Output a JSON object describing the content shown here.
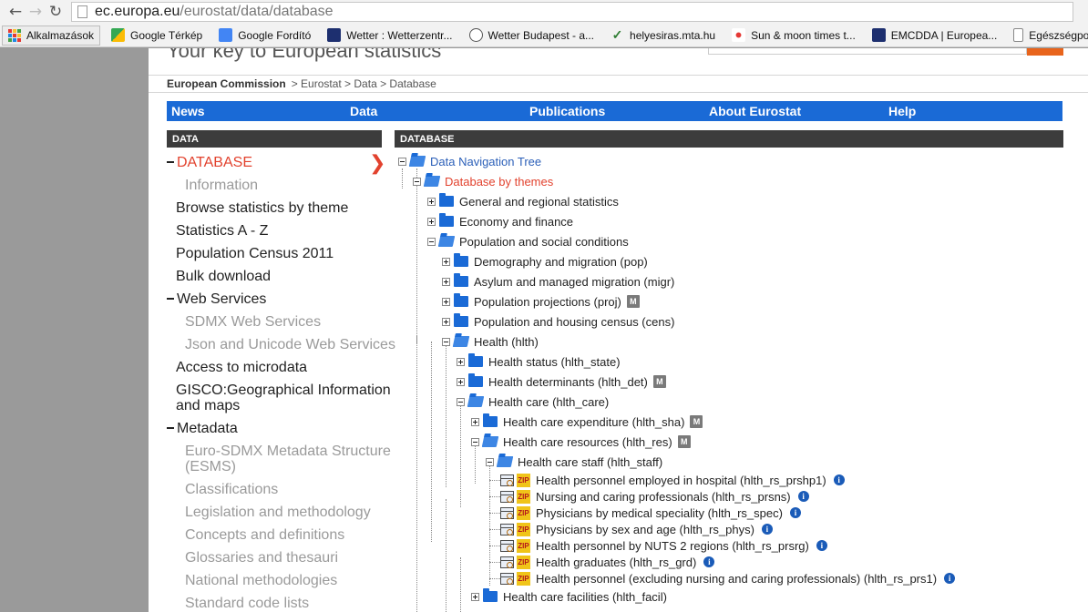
{
  "browser": {
    "url_host": "ec.europa.eu",
    "url_path": "/eurostat/data/database"
  },
  "bookmarks": [
    {
      "label": "Alkalmazások",
      "color": "#e44"
    },
    {
      "label": "Google Térkép",
      "color": "#34a853"
    },
    {
      "label": "Google Fordító",
      "color": "#4285f4"
    },
    {
      "label": "Wetter : Wetterzentr...",
      "color": "#1d2f6f"
    },
    {
      "label": "Wetter Budapest - a...",
      "color": "#ffffff"
    },
    {
      "label": "helyesiras.mta.hu",
      "color": "#ffffff"
    },
    {
      "label": "Sun & moon times t...",
      "color": "#ffffff"
    },
    {
      "label": "EMCDDA | Europea...",
      "color": "#1d2f6f"
    },
    {
      "label": "Egészségportál",
      "color": "#ffffff"
    }
  ],
  "site": {
    "title": "Your key to European statistics"
  },
  "breadcrumb": {
    "home": "European Commission",
    "trail": "> Eurostat  > Data > Database"
  },
  "mainnav": [
    "News",
    "Data",
    "Publications",
    "About Eurostat",
    "Help"
  ],
  "panels": {
    "left": "DATA",
    "right": "DATABASE"
  },
  "sidebar": [
    {
      "label": "DATABASE",
      "style": "active"
    },
    {
      "label": "Information",
      "style": "grey"
    },
    {
      "label": "Browse statistics by theme",
      "style": "normal"
    },
    {
      "label": "Statistics A - Z",
      "style": "normal"
    },
    {
      "label": "Population Census 2011",
      "style": "normal"
    },
    {
      "label": "Bulk download",
      "style": "normal"
    },
    {
      "label": "Web Services",
      "style": "normal"
    },
    {
      "label": "SDMX Web Services",
      "style": "grey"
    },
    {
      "label": "Json and Unicode Web Services",
      "style": "grey"
    },
    {
      "label": "Access to microdata",
      "style": "normal"
    },
    {
      "label": "GISCO:Geographical Information",
      "style": "normal"
    },
    {
      "label": "and maps",
      "style": "normal"
    },
    {
      "label": "Metadata",
      "style": "normal"
    },
    {
      "label": "Euro-SDMX Metadata Structure",
      "style": "grey"
    },
    {
      "label": "(ESMS)",
      "style": "grey"
    },
    {
      "label": "Classifications",
      "style": "grey"
    },
    {
      "label": "Legislation and methodology",
      "style": "grey"
    },
    {
      "label": "Concepts and definitions",
      "style": "grey"
    },
    {
      "label": "Glossaries and thesauri",
      "style": "grey"
    },
    {
      "label": "National methodologies",
      "style": "grey"
    },
    {
      "label": "Standard code lists",
      "style": "grey"
    }
  ],
  "tree": [
    {
      "label": "Data Navigation Tree",
      "kind": "root",
      "state": "open"
    },
    {
      "label": "Database by themes",
      "kind": "themes",
      "state": "open"
    },
    {
      "label": "General and regional statistics",
      "kind": "folder",
      "state": "closed"
    },
    {
      "label": "Economy and finance",
      "kind": "folder",
      "state": "closed"
    },
    {
      "label": "Population and social conditions",
      "kind": "folder",
      "state": "open"
    },
    {
      "label": "Demography and migration (pop)",
      "kind": "folder",
      "state": "closed"
    },
    {
      "label": "Asylum and managed migration (migr)",
      "kind": "folder",
      "state": "closed"
    },
    {
      "label": "Population projections (proj)",
      "kind": "folder",
      "state": "closed",
      "badge": "M"
    },
    {
      "label": "Population and housing census (cens)",
      "kind": "folder",
      "state": "closed"
    },
    {
      "label": "Health (hlth)",
      "kind": "folder",
      "state": "open"
    },
    {
      "label": "Health status (hlth_state)",
      "kind": "folder",
      "state": "closed"
    },
    {
      "label": "Health determinants (hlth_det)",
      "kind": "folder",
      "state": "closed",
      "badge": "M"
    },
    {
      "label": "Health care (hlth_care)",
      "kind": "folder",
      "state": "open"
    },
    {
      "label": "Health care expenditure (hlth_sha)",
      "kind": "folder",
      "state": "closed",
      "badge": "M"
    },
    {
      "label": "Health care resources (hlth_res)",
      "kind": "folder",
      "state": "open",
      "badge": "M"
    },
    {
      "label": "Health care staff (hlth_staff)",
      "kind": "folder",
      "state": "open"
    },
    {
      "label": "Health personnel employed in hospital (hlth_rs_prshp1)",
      "kind": "table"
    },
    {
      "label": "Nursing and caring professionals (hlth_rs_prsns)",
      "kind": "table"
    },
    {
      "label": "Physicians by medical speciality (hlth_rs_spec)",
      "kind": "table"
    },
    {
      "label": "Physicians by sex and age (hlth_rs_phys)",
      "kind": "table"
    },
    {
      "label": "Health personnel by NUTS 2 regions (hlth_rs_prsrg)",
      "kind": "table"
    },
    {
      "label": "Health graduates (hlth_rs_grd)",
      "kind": "table"
    },
    {
      "label": "Health personnel (excluding nursing and caring professionals) (hlth_rs_prs1)",
      "kind": "table"
    },
    {
      "label": "Health care facilities (hlth_facil)",
      "kind": "folder",
      "state": "closed"
    }
  ],
  "icons": {
    "zip": "ZIP",
    "metadata": "M",
    "info": "i"
  }
}
